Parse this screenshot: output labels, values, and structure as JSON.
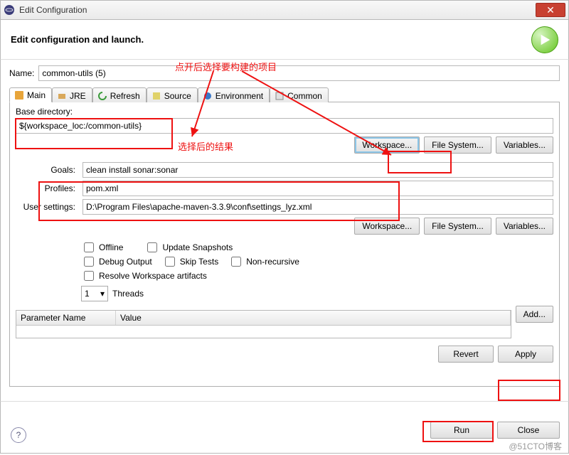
{
  "window": {
    "title": "Edit Configuration"
  },
  "banner": {
    "text": "Edit configuration and launch."
  },
  "annotations": {
    "top": "点开后选择要构建的项目",
    "result": "选择后的结果"
  },
  "name": {
    "label": "Name:",
    "value": "common-utils (5)"
  },
  "tabs": {
    "main": "Main",
    "jre": "JRE",
    "refresh": "Refresh",
    "source": "Source",
    "env": "Environment",
    "common": "Common"
  },
  "base": {
    "label": "Base directory:",
    "value": "${workspace_loc:/common-utils}"
  },
  "buttons": {
    "workspace": "Workspace...",
    "filesystem": "File System...",
    "variables": "Variables...",
    "add": "Add...",
    "revert": "Revert",
    "apply": "Apply",
    "run": "Run",
    "close": "Close"
  },
  "goals": {
    "label": "Goals:",
    "value": "clean install sonar:sonar"
  },
  "profiles": {
    "label": "Profiles:",
    "value": "pom.xml"
  },
  "usersettings": {
    "label": "User settings:",
    "value": "D:\\Program Files\\apache-maven-3.3.9\\conf\\settings_lyz.xml"
  },
  "checks": {
    "offline": "Offline",
    "update": "Update Snapshots",
    "debug": "Debug Output",
    "skip": "Skip Tests",
    "nonrec": "Non-recursive",
    "resolve": "Resolve Workspace artifacts"
  },
  "threads": {
    "value": "1",
    "label": "Threads"
  },
  "table": {
    "col1": "Parameter Name",
    "col2": "Value"
  },
  "watermark": "@51CTO博客"
}
